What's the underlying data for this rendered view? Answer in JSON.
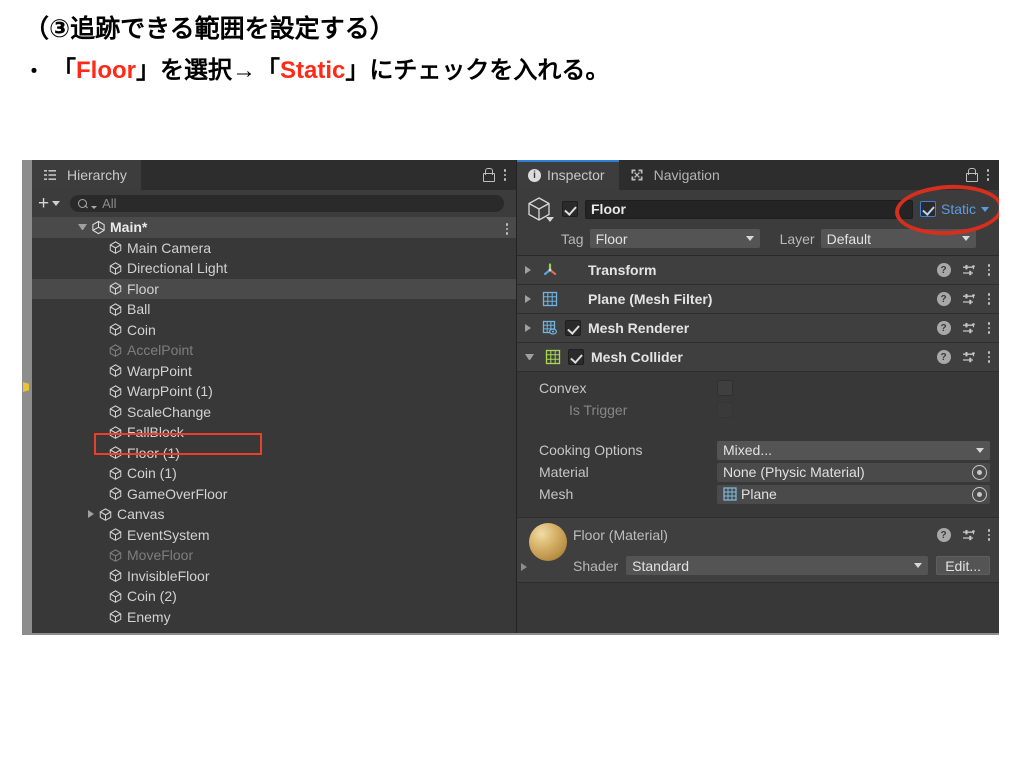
{
  "slide": {
    "heading": "（③追跡できる範囲を設定する）",
    "bullet_mark": "・",
    "bullet_parts": {
      "open1": "「",
      "red1": "Floor",
      "close1": "」",
      "mid": "を選択→",
      "open2": "「",
      "red2": "Static",
      "close2": "」",
      "tail": "にチェックを入れる。"
    }
  },
  "hierarchy": {
    "tab_label": "Hierarchy",
    "tab_icon": "hierarchy-icon",
    "lock_icon": "lock-icon",
    "menu_icon": "kebab-menu-icon",
    "add_button_label": "+",
    "search_placeholder": "All",
    "scene": {
      "label": "Main*",
      "icon": "unity-scene-icon",
      "expanded": true
    },
    "items": [
      {
        "label": "Main Camera",
        "dim": false,
        "selected": false,
        "expandable": false
      },
      {
        "label": "Directional Light",
        "dim": false,
        "selected": false,
        "expandable": false
      },
      {
        "label": "Floor",
        "dim": false,
        "selected": true,
        "expandable": false
      },
      {
        "label": "Ball",
        "dim": false,
        "selected": false,
        "expandable": false
      },
      {
        "label": "Coin",
        "dim": false,
        "selected": false,
        "expandable": false
      },
      {
        "label": "AccelPoint",
        "dim": true,
        "selected": false,
        "expandable": false
      },
      {
        "label": "WarpPoint",
        "dim": false,
        "selected": false,
        "expandable": false
      },
      {
        "label": "WarpPoint (1)",
        "dim": false,
        "selected": false,
        "expandable": false
      },
      {
        "label": "ScaleChange",
        "dim": false,
        "selected": false,
        "expandable": false
      },
      {
        "label": "FallBlock",
        "dim": false,
        "selected": false,
        "expandable": false
      },
      {
        "label": "Floor (1)",
        "dim": false,
        "selected": false,
        "expandable": false
      },
      {
        "label": "Coin (1)",
        "dim": false,
        "selected": false,
        "expandable": false
      },
      {
        "label": "GameOverFloor",
        "dim": false,
        "selected": false,
        "expandable": false
      },
      {
        "label": "Canvas",
        "dim": false,
        "selected": false,
        "expandable": true
      },
      {
        "label": "EventSystem",
        "dim": false,
        "selected": false,
        "expandable": false
      },
      {
        "label": "MoveFloor",
        "dim": true,
        "selected": false,
        "expandable": false
      },
      {
        "label": "InvisibleFloor",
        "dim": false,
        "selected": false,
        "expandable": false
      },
      {
        "label": "Coin (2)",
        "dim": false,
        "selected": false,
        "expandable": false
      },
      {
        "label": "Enemy",
        "dim": false,
        "selected": false,
        "expandable": false
      }
    ]
  },
  "inspector": {
    "tabs": [
      {
        "label": "Inspector",
        "icon": "info-icon",
        "active": true
      },
      {
        "label": "Navigation",
        "icon": "navigation-icon",
        "active": false
      }
    ],
    "lock_icon": "lock-icon",
    "menu_icon": "kebab-menu-icon",
    "object": {
      "icon": "gameobject-cube-icon",
      "enabled": true,
      "name": "Floor",
      "static_label": "Static",
      "static_checked": true,
      "tag_label": "Tag",
      "tag_value": "Floor",
      "layer_label": "Layer",
      "layer_value": "Default"
    },
    "components": [
      {
        "title": "Transform",
        "icon": "transform-axis-icon",
        "expanded": false,
        "has_enable_checkbox": false,
        "enabled": false
      },
      {
        "title": "Plane (Mesh Filter)",
        "icon": "mesh-filter-icon",
        "expanded": false,
        "has_enable_checkbox": false,
        "enabled": false
      },
      {
        "title": "Mesh Renderer",
        "icon": "mesh-renderer-icon",
        "expanded": false,
        "has_enable_checkbox": true,
        "enabled": true
      },
      {
        "title": "Mesh Collider",
        "icon": "mesh-collider-icon",
        "expanded": true,
        "has_enable_checkbox": true,
        "enabled": true
      }
    ],
    "mesh_collider_props": {
      "convex_label": "Convex",
      "convex_checked": false,
      "is_trigger_label": "Is Trigger",
      "is_trigger_checked": false,
      "is_trigger_disabled": true,
      "cooking_label": "Cooking Options",
      "cooking_value": "Mixed...",
      "material_label": "Material",
      "material_value": "None (Physic Material)",
      "mesh_label": "Mesh",
      "mesh_value": "Plane"
    },
    "material_block": {
      "title": "Floor (Material)",
      "shader_label": "Shader",
      "shader_value": "Standard",
      "edit_label": "Edit...",
      "help_icon": "help-icon",
      "settings_icon": "settings-sliders-icon",
      "menu_icon": "kebab-menu-icon"
    }
  },
  "annotations": {
    "hierarchy_highlight": "red-rectangle-around-floor",
    "static_highlight": "red-ellipse-around-static-checkbox",
    "accent_red": "#e8402a",
    "accent_blue": "#5c9bdf"
  }
}
